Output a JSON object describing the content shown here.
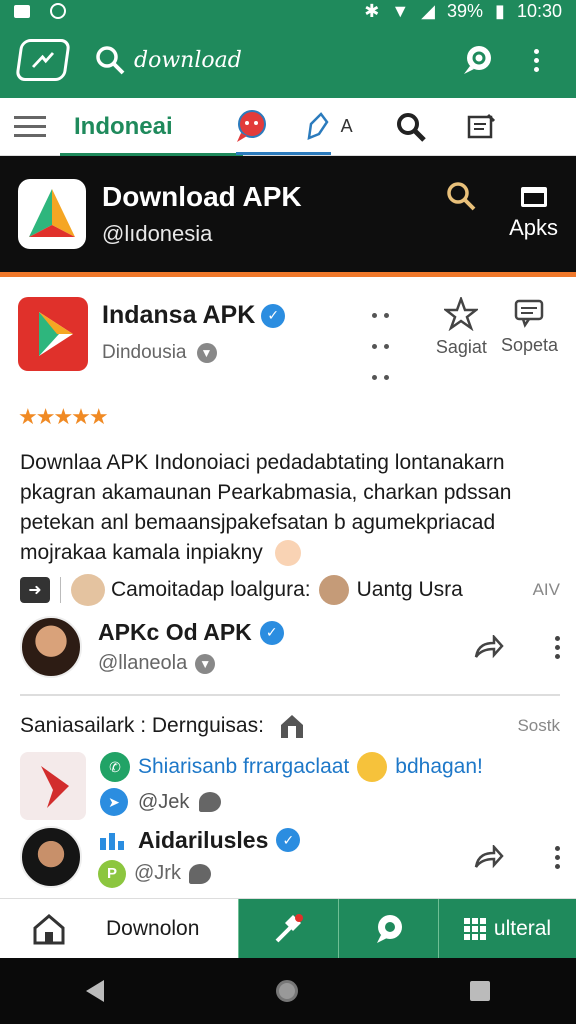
{
  "status_bar": {
    "battery": "39%",
    "time": "10:30"
  },
  "app_bar": {
    "search_placeholder": "download"
  },
  "tabs": {
    "active_label": "Indoneai",
    "a_label": "A"
  },
  "hero": {
    "title": "Download APK",
    "subtitle": "@lıdonesia",
    "apks_label": "Apks"
  },
  "app": {
    "name": "Indansa APK",
    "developer": "Dindousia",
    "rating_stars": "★★★★★",
    "rating_value": 5,
    "action_save": "Sagiat",
    "action_report": "Sopeta"
  },
  "description": "Downlaa APK Indonoiaci pedadabtating lontanakarn pkagran akamaunan Pearkabmasia, charkan pdssan petekan anl bemaansjpakefsatan b agumekpriacad mojrakaa kamala inpiakny",
  "share_row": {
    "text": "Camoitadap loalgura:",
    "user": "Uantg Usra",
    "tag": "AIV"
  },
  "post1": {
    "name": "APKc Od APK",
    "handle": "@llaneola"
  },
  "section": {
    "title": "Saniasailark : Dernguisas:",
    "sort_label": "Sostk"
  },
  "feed1": {
    "text": "Shiarisanb frrargaclaat",
    "text2": "bdhagan!",
    "handle": "@Jek"
  },
  "post2": {
    "name": "Aidarilusles",
    "handle": "@Jrk",
    "p_badge": "P"
  },
  "bottom_nav": {
    "home_label": "Downolon",
    "ulteral_label": "ulteral"
  },
  "colors": {
    "primary": "#1f8a5c",
    "accent": "#f0782a",
    "verified": "#2b8de0",
    "star": "#f08a24"
  }
}
